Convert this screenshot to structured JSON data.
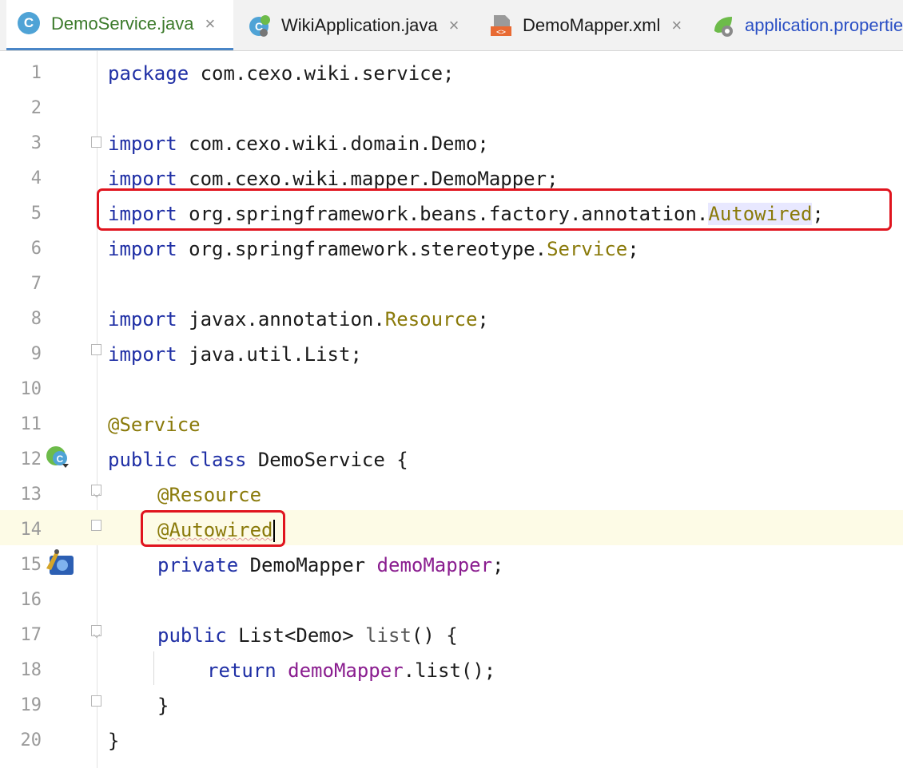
{
  "tabs": [
    {
      "label": "DemoService.java",
      "icon": "java-class-icon",
      "active": true
    },
    {
      "label": "WikiApplication.java",
      "icon": "spring-app-icon",
      "active": false
    },
    {
      "label": "DemoMapper.xml",
      "icon": "xml-file-icon",
      "active": false
    },
    {
      "label": "application.properties",
      "icon": "spring-properties-icon",
      "active": false
    }
  ],
  "tab_close_glyph": "×",
  "class_icon_letter": "C",
  "editor": {
    "line_numbers": [
      "1",
      "2",
      "3",
      "4",
      "5",
      "6",
      "7",
      "8",
      "9",
      "10",
      "11",
      "12",
      "13",
      "14",
      "15",
      "16",
      "17",
      "18",
      "19",
      "20"
    ],
    "current_line": "14",
    "lines": {
      "l1": {
        "kw": "package",
        "rest": " com.cexo.wiki.service;"
      },
      "l3": {
        "kw": "import",
        "rest": " com.cexo.wiki.domain.Demo;"
      },
      "l4": {
        "kw": "import",
        "rest": " com.cexo.wiki.mapper.DemoMapper;"
      },
      "l5": {
        "kw": "import",
        "rest": " org.springframework.beans.factory.annotation.",
        "ann": "Autowired",
        "end": ";"
      },
      "l6": {
        "kw": "import",
        "rest": " org.springframework.stereotype.",
        "ann": "Service",
        "end": ";"
      },
      "l8": {
        "kw": "import",
        "rest": " javax.annotation.",
        "ann": "Resource",
        "end": ";"
      },
      "l9": {
        "kw": "import",
        "rest": " java.util.List;"
      },
      "l11": {
        "ann": "@Service"
      },
      "l12": {
        "kw1": "public",
        "kw2": "class",
        "rest": " DemoService {"
      },
      "l13": {
        "ann": "@Resource"
      },
      "l14": {
        "ann": "@Autowired"
      },
      "l15": {
        "kw": "private",
        "type": " DemoMapper ",
        "field": "demoMapper",
        "end": ";"
      },
      "l17": {
        "kw": "public",
        "type": " List<Demo> ",
        "method": "list",
        "end": "() {"
      },
      "l18": {
        "kw": "return",
        "field": "demoMapper",
        "end": ".list();"
      },
      "l19": {
        "text": "}"
      },
      "l20": {
        "text": "}"
      }
    },
    "gutter_icons": {
      "l12": "spring-bean-icon",
      "l15": "injection-point-icon"
    }
  },
  "colors": {
    "keyword": "#1f2fa5",
    "annotation": "#8a7a0a",
    "field": "#8a1d8f",
    "highlight_box": "#e0141e"
  }
}
